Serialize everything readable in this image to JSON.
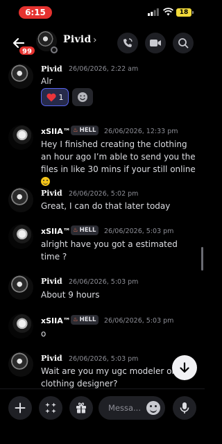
{
  "status_bar": {
    "time": "6:15",
    "battery": "18"
  },
  "header": {
    "name": "Pivid",
    "unread_count": "99"
  },
  "messages": [
    {
      "author": "Pivid",
      "timestamp": "26/06/2026, 2:22 am",
      "text": "Alr",
      "reaction": {
        "emoji": "heart",
        "count": "1"
      }
    },
    {
      "author": "xSIIA™",
      "tag": "HELL",
      "timestamp": "26/06/2026, 12:33 pm",
      "text": "Hey I finished creating the clothing an hour ago I’m able to send you the files in like 30 mins if your still online",
      "trailing_emoji": "slightly-smiling-face"
    },
    {
      "author": "Pivid",
      "timestamp": "26/06/2026, 5:02 pm",
      "text": "Great, I can do that later today"
    },
    {
      "author": "xSIIA™",
      "tag": "HELL",
      "timestamp": "26/06/2026, 5:03 pm",
      "text": "alright have you got a estimated time ?"
    },
    {
      "author": "Pivid",
      "timestamp": "26/06/2026, 5:03 pm",
      "text": "About 9 hours"
    },
    {
      "author": "xSIIA™",
      "tag": "HELL",
      "timestamp": "26/06/2026, 5:03 pm",
      "text": "o"
    },
    {
      "author": "Pivid",
      "timestamp": "26/06/2026, 5:03 pm",
      "text": "Wait are you my ugc modeler or clothing designer?"
    }
  ],
  "composer": {
    "placeholder": "Messa..."
  },
  "colors": {
    "accent": "#5865f2",
    "badge_red": "#e5322f",
    "background": "#000000"
  },
  "icons": [
    "back-arrow-icon",
    "call-icon",
    "video-icon",
    "search-icon",
    "plus-icon",
    "apps-icon",
    "gift-icon",
    "emoji-icon",
    "microphone-icon",
    "arrow-down-icon"
  ]
}
